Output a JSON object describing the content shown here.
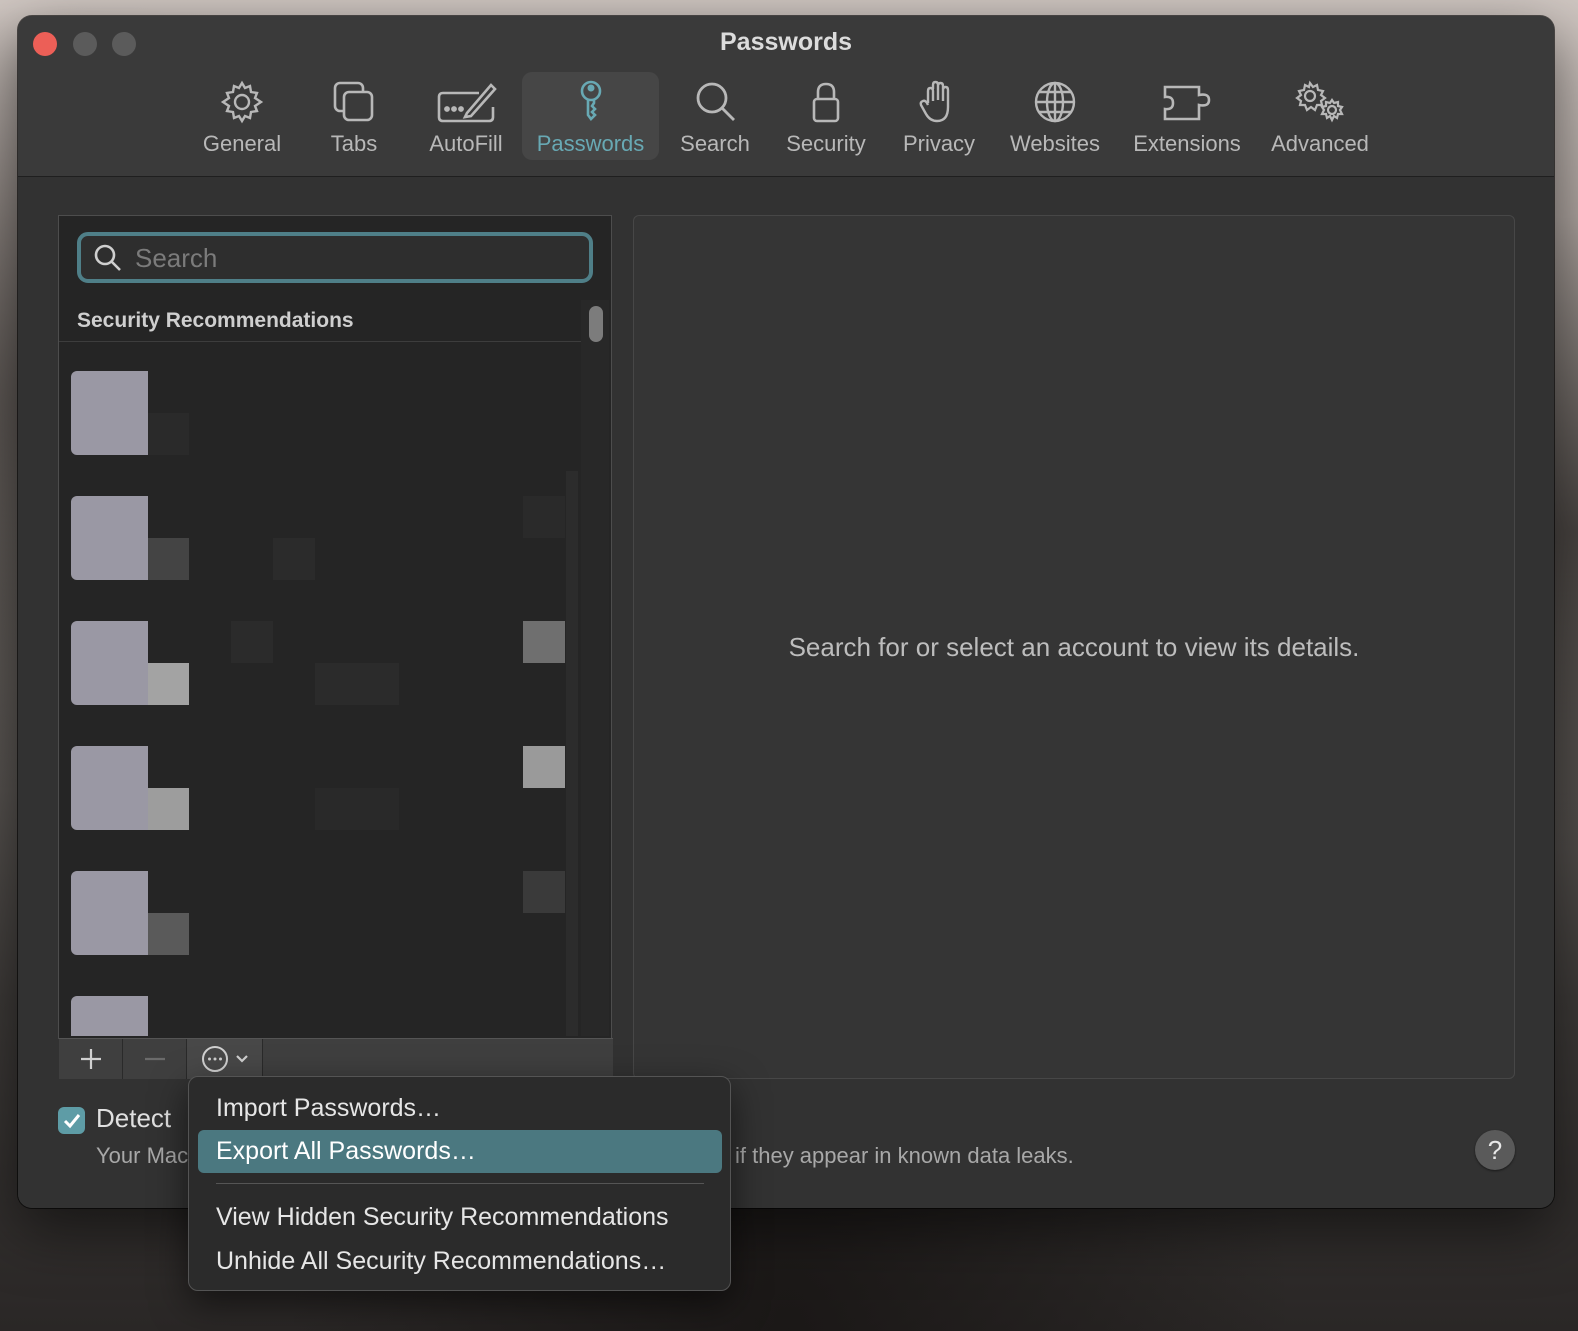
{
  "window": {
    "title": "Passwords"
  },
  "toolbar": {
    "items": [
      {
        "label": "General",
        "icon": "gear-icon"
      },
      {
        "label": "Tabs",
        "icon": "tabs-icon"
      },
      {
        "label": "AutoFill",
        "icon": "autofill-icon"
      },
      {
        "label": "Passwords",
        "icon": "key-icon",
        "active": true
      },
      {
        "label": "Search",
        "icon": "search-icon"
      },
      {
        "label": "Security",
        "icon": "lock-icon"
      },
      {
        "label": "Privacy",
        "icon": "hand-icon"
      },
      {
        "label": "Websites",
        "icon": "globe-icon"
      },
      {
        "label": "Extensions",
        "icon": "puzzle-icon"
      },
      {
        "label": "Advanced",
        "icon": "gears-icon"
      }
    ]
  },
  "sidebar": {
    "search_placeholder": "Search",
    "section_header": "Security Recommendations"
  },
  "detail": {
    "empty_message": "Search for or select an account to view its details."
  },
  "footer": {
    "detect_label": "Detect",
    "detect_checked": true,
    "detect_desc_visible_start": "Your Mac",
    "detect_desc_visible_end": "if they appear in known data leaks.",
    "help_label": "?"
  },
  "menu": {
    "items": [
      {
        "label": "Import Passwords…"
      },
      {
        "label": "Export All Passwords…",
        "highlighted": true
      },
      {
        "label": "View Hidden Security Recommendations"
      },
      {
        "label": "Unhide All Security Recommendations…"
      }
    ]
  },
  "colors": {
    "accent": "#68a9b4",
    "highlight": "#4b7880",
    "close_button": "#ec5f57",
    "window_bg": "#323232"
  }
}
